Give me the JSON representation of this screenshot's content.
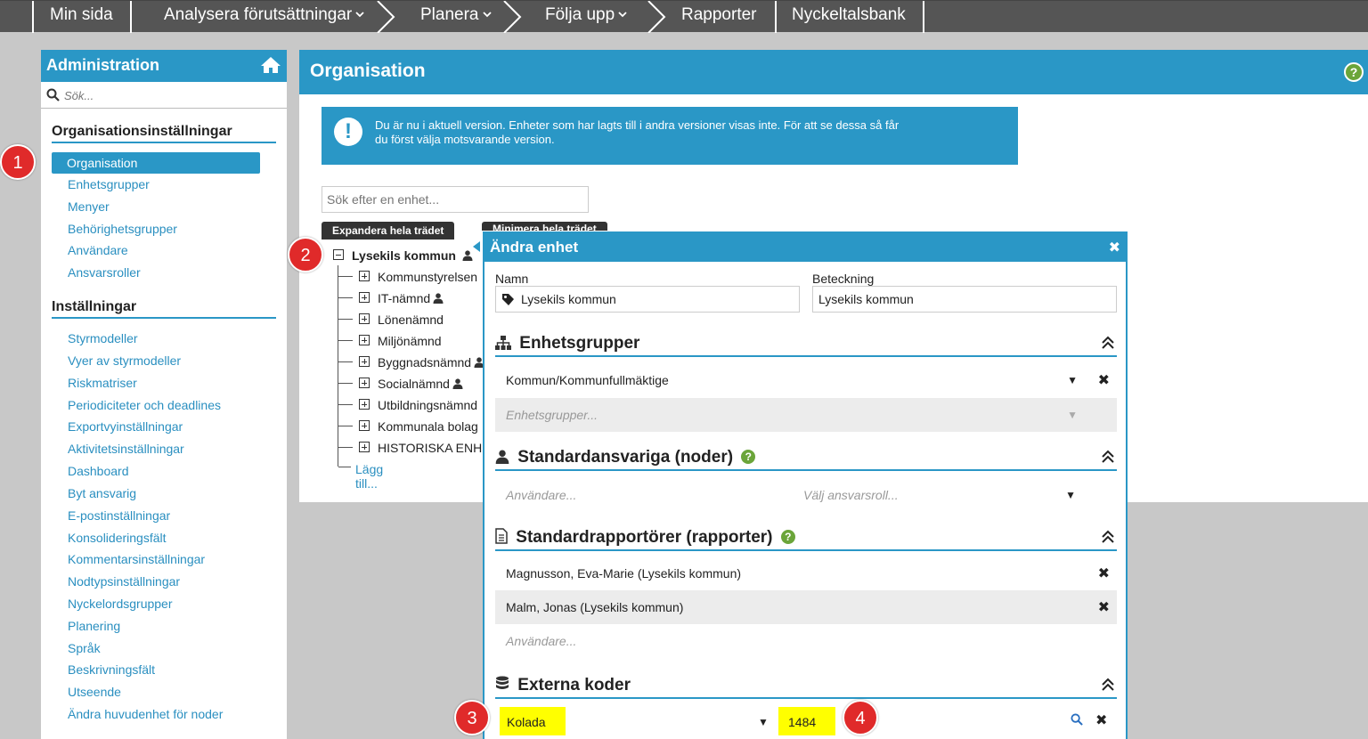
{
  "topnav": {
    "items": [
      "Min sida",
      "Analysera förutsättningar",
      "Planera",
      "Följa upp",
      "Rapporter",
      "Nyckeltalsbank"
    ],
    "caret": "⌄"
  },
  "sidebar": {
    "title": "Administration",
    "search_placeholder": "Sök...",
    "section1": "Organisationsinställningar",
    "links1": [
      "Organisation",
      "Enhetsgrupper",
      "Menyer",
      "Behörighetsgrupper",
      "Användare",
      "Ansvarsroller"
    ],
    "section2": "Inställningar",
    "links2": [
      "Styrmodeller",
      "Vyer av styrmodeller",
      "Riskmatriser",
      "Periodiciteter och deadlines",
      "Exportvyinställningar",
      "Aktivitetsinställningar",
      "Dashboard",
      "Byt ansvarig",
      "E-postinställningar",
      "Konsolideringsfält",
      "Kommentarsinställningar",
      "Nodtypsinställningar",
      "Nyckelordsgrupper",
      "Planering",
      "Språk",
      "Beskrivningsfält",
      "Utseende",
      "Ändra huvudenhet för noder"
    ]
  },
  "badges": [
    "1",
    "2",
    "3",
    "4"
  ],
  "main": {
    "title": "Organisation",
    "help": "?",
    "info_line1": "Du är nu i aktuell version. Enheter som har lagts till i andra versioner visas inte. För att se dessa så får",
    "info_line2": "du först välja motsvarande version.",
    "unit_search_placeholder": "Sök efter en enhet...",
    "expand_btn": "Expandera hela trädet",
    "minimize_btn": "Minimera hela trädet",
    "root": "Lysekils kommun",
    "children": [
      "Kommunstyrelsen",
      "IT-nämnd",
      "Lönenämnd",
      "Miljönämnd",
      "Byggnadsnämnd",
      "Socialnämnd",
      "Utbildningsnämnd",
      "Kommunala bolag",
      "HISTORISKA ENH"
    ],
    "add": "Lägg till..."
  },
  "dialog": {
    "title": "Ändra enhet",
    "close": "✖",
    "name_label": "Namn",
    "name_value": "Lysekils kommun",
    "desig_label": "Beteckning",
    "desig_value": "Lysekils kommun",
    "sec_groups": "Enhetsgrupper",
    "group_value": "Kommun/Kommunfullmäktige",
    "group_placeholder": "Enhetsgrupper...",
    "sec_resp": "Standardansvariga (noder)",
    "user_placeholder": "Användare...",
    "role_placeholder": "Välj ansvarsroll...",
    "sec_rep": "Standardrapportörer (rapporter)",
    "reporters": [
      "Magnusson, Eva-Marie (Lysekils kommun)",
      "Malm, Jonas (Lysekils kommun)"
    ],
    "reporter_placeholder": "Användare...",
    "sec_ext": "Externa koder",
    "ext_system": "Kolada",
    "ext_code": "1484",
    "qmark": "?",
    "x": "✖",
    "tri": "▼"
  },
  "colors": {
    "accent": "#2a97c6",
    "badge": "#e02a2a",
    "highlight": "#ffff00",
    "help": "#6ba53a",
    "nav": "#555555"
  }
}
